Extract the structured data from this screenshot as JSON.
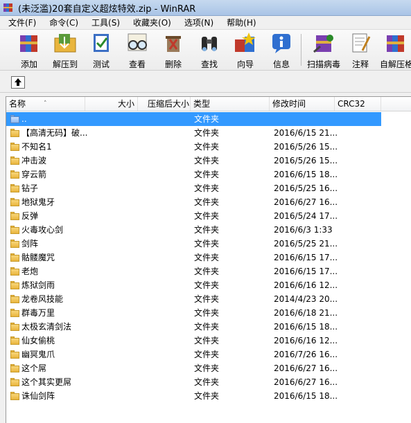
{
  "window": {
    "title": "(未泛滥)20套自定义超炫特效.zip - WinRAR"
  },
  "menu": [
    {
      "id": "file",
      "label": "文件(F)"
    },
    {
      "id": "commands",
      "label": "命令(C)"
    },
    {
      "id": "tools",
      "label": "工具(S)"
    },
    {
      "id": "favorites",
      "label": "收藏夹(O)"
    },
    {
      "id": "options",
      "label": "选项(N)"
    },
    {
      "id": "help",
      "label": "帮助(H)"
    }
  ],
  "toolbar": [
    {
      "id": "add",
      "label": "添加",
      "icon": "add-books-icon"
    },
    {
      "id": "extract",
      "label": "解压到",
      "icon": "extract-folder-icon"
    },
    {
      "id": "test",
      "label": "测试",
      "icon": "test-check-icon"
    },
    {
      "id": "view",
      "label": "查看",
      "icon": "view-glasses-icon"
    },
    {
      "id": "delete",
      "label": "删除",
      "icon": "delete-recycle-icon"
    },
    {
      "id": "find",
      "label": "查找",
      "icon": "find-binoculars-icon"
    },
    {
      "id": "wizard",
      "label": "向导",
      "icon": "wizard-icon"
    },
    {
      "id": "info",
      "label": "信息",
      "icon": "info-icon"
    },
    {
      "id": "scan",
      "label": "扫描病毒",
      "icon": "virus-scan-icon"
    },
    {
      "id": "comment",
      "label": "注释",
      "icon": "comment-icon"
    },
    {
      "id": "sfx",
      "label": "自解压格",
      "icon": "sfx-icon"
    }
  ],
  "columns": {
    "name": "名称",
    "size": "大小",
    "packed": "压缩后大小",
    "type": "类型",
    "modified": "修改时间",
    "crc": "CRC32"
  },
  "files": [
    {
      "name": "..",
      "type": "文件夹",
      "modified": "",
      "parent": true,
      "selected": true
    },
    {
      "name": "【高清无码】破...",
      "type": "文件夹",
      "modified": "2016/6/15 21..."
    },
    {
      "name": "不知名1",
      "type": "文件夹",
      "modified": "2016/5/26 15..."
    },
    {
      "name": "冲击波",
      "type": "文件夹",
      "modified": "2016/5/26 15..."
    },
    {
      "name": "穿云箭",
      "type": "文件夹",
      "modified": "2016/6/15 18..."
    },
    {
      "name": "钻子",
      "type": "文件夹",
      "modified": "2016/5/25 16..."
    },
    {
      "name": "地狱鬼牙",
      "type": "文件夹",
      "modified": "2016/6/27 16..."
    },
    {
      "name": "反弹",
      "type": "文件夹",
      "modified": "2016/5/24 17..."
    },
    {
      "name": "火毒攻心剑",
      "type": "文件夹",
      "modified": "2016/6/3 1:33"
    },
    {
      "name": "剑阵",
      "type": "文件夹",
      "modified": "2016/5/25 21..."
    },
    {
      "name": "骷髅魔咒",
      "type": "文件夹",
      "modified": "2016/6/15 17..."
    },
    {
      "name": "老炮",
      "type": "文件夹",
      "modified": "2016/6/15 17..."
    },
    {
      "name": "炼狱剑雨",
      "type": "文件夹",
      "modified": "2016/6/16 12..."
    },
    {
      "name": "龙卷风技能",
      "type": "文件夹",
      "modified": "2014/4/23 20..."
    },
    {
      "name": "群毒万里",
      "type": "文件夹",
      "modified": "2016/6/18 21..."
    },
    {
      "name": "太极玄清剑法",
      "type": "文件夹",
      "modified": "2016/6/15 18..."
    },
    {
      "name": "仙女偷桃",
      "type": "文件夹",
      "modified": "2016/6/16 12..."
    },
    {
      "name": "幽冥鬼爪",
      "type": "文件夹",
      "modified": "2016/7/26 16..."
    },
    {
      "name": "这个屌",
      "type": "文件夹",
      "modified": "2016/6/27 16..."
    },
    {
      "name": "这个其实更屌",
      "type": "文件夹",
      "modified": "2016/6/27 16..."
    },
    {
      "name": "诛仙剑阵",
      "type": "文件夹",
      "modified": "2016/6/15 18..."
    }
  ]
}
